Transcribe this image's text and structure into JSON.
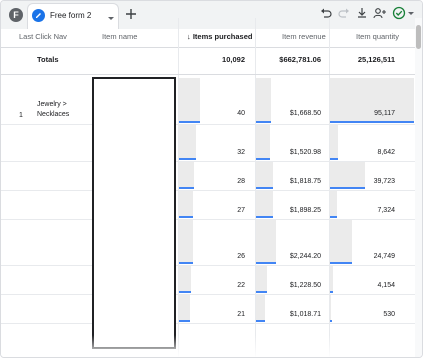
{
  "toolbar": {
    "user_initial": "F",
    "tab_label": "Free form 2",
    "icons": [
      "undo-icon",
      "redo-icon",
      "download-icon",
      "share-user-icon",
      "check-status-icon",
      "dropdown-caret-icon",
      "add-tab-icon"
    ]
  },
  "columns": {
    "dimension1": "Last Click Nav",
    "dimension2": "Item name",
    "metric1": "Items purchased",
    "metric2": "Item revenue",
    "metric3": "Item quantity",
    "sort_indicator": "↓"
  },
  "totals": {
    "label": "Totals",
    "items_purchased": "10,092",
    "item_revenue": "$662,781.06",
    "item_quantity": "25,126,511"
  },
  "rows": [
    {
      "index": "1",
      "dimension1_line1": "Jewelry >",
      "dimension1_line2": "Necklaces",
      "items_purchased": "40",
      "item_revenue": "$1,668.50",
      "item_quantity": "95,117",
      "purchased_fill": 1.0,
      "revenue_fill": 0.74,
      "quantity_fill": 1.0
    },
    {
      "index": "",
      "items_purchased": "32",
      "item_revenue": "$1,520.98",
      "item_quantity": "8,642",
      "purchased_fill": 0.8,
      "revenue_fill": 0.68,
      "quantity_fill": 0.09
    },
    {
      "index": "",
      "items_purchased": "28",
      "item_revenue": "$1,818.75",
      "item_quantity": "39,723",
      "purchased_fill": 0.7,
      "revenue_fill": 0.81,
      "quantity_fill": 0.42
    },
    {
      "index": "",
      "items_purchased": "27",
      "item_revenue": "$1,898.25",
      "item_quantity": "7,324",
      "purchased_fill": 0.68,
      "revenue_fill": 0.85,
      "quantity_fill": 0.08
    },
    {
      "index": "",
      "items_purchased": "26",
      "item_revenue": "$2,244.20",
      "item_quantity": "24,749",
      "purchased_fill": 0.65,
      "revenue_fill": 1.0,
      "quantity_fill": 0.26
    },
    {
      "index": "",
      "items_purchased": "22",
      "item_revenue": "$1,228.50",
      "item_quantity": "4,154",
      "purchased_fill": 0.55,
      "revenue_fill": 0.55,
      "quantity_fill": 0.04
    },
    {
      "index": "",
      "items_purchased": "21",
      "item_revenue": "$1,018.71",
      "item_quantity": "530",
      "purchased_fill": 0.53,
      "revenue_fill": 0.45,
      "quantity_fill": 0.01
    }
  ],
  "colors": {
    "accent": "#1a73e8",
    "bar_line": "#4285f4",
    "bar_fill": "#ebebeb",
    "status_ok": "#188038"
  }
}
